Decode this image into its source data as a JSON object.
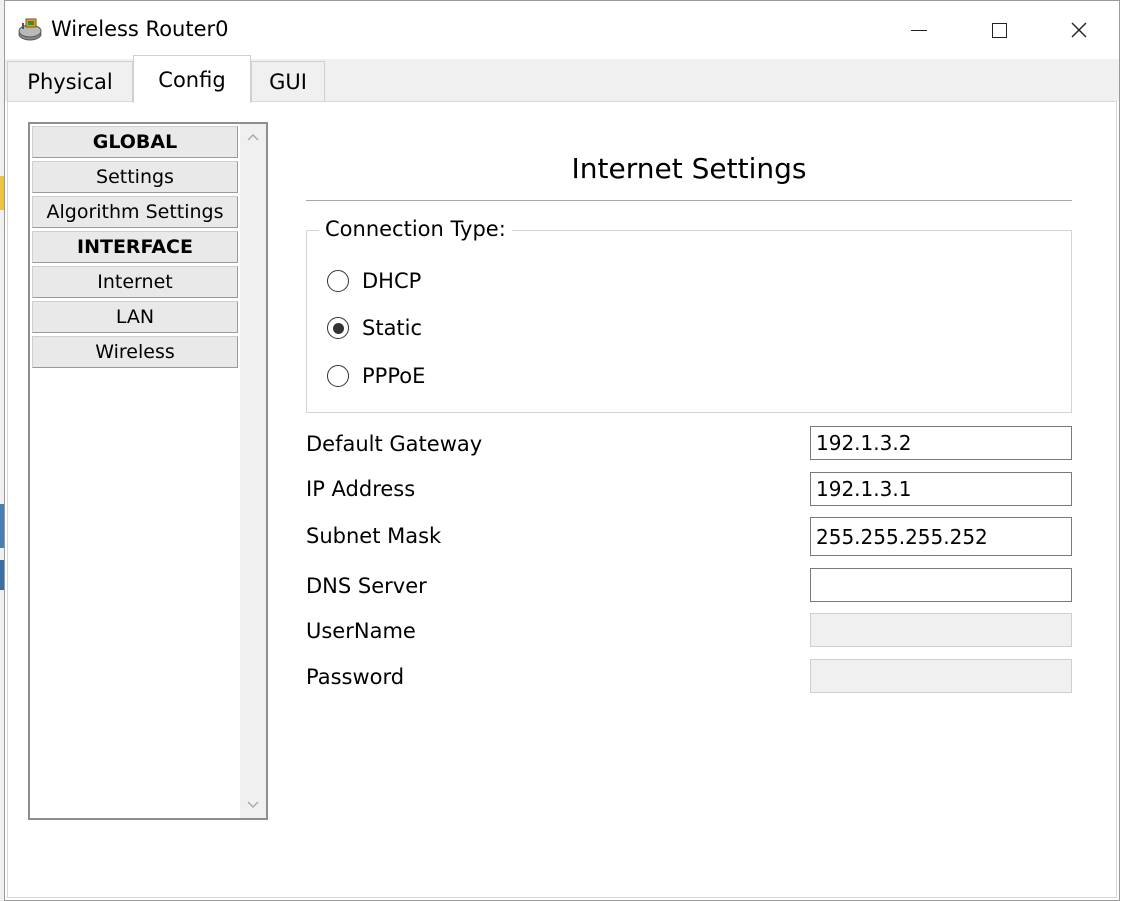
{
  "window": {
    "title": "Wireless Router0",
    "icon": "router-icon"
  },
  "tabs": [
    {
      "label": "Physical",
      "selected": false
    },
    {
      "label": "Config",
      "selected": true
    },
    {
      "label": "GUI",
      "selected": false
    }
  ],
  "sidebar": {
    "items": [
      {
        "label": "GLOBAL",
        "type": "header"
      },
      {
        "label": "Settings",
        "type": "item"
      },
      {
        "label": "Algorithm Settings",
        "type": "item"
      },
      {
        "label": "INTERFACE",
        "type": "header"
      },
      {
        "label": "Internet",
        "type": "item"
      },
      {
        "label": "LAN",
        "type": "item"
      },
      {
        "label": "Wireless",
        "type": "item"
      }
    ]
  },
  "main": {
    "heading": "Internet Settings",
    "connection_type": {
      "legend": "Connection Type:",
      "options": [
        "DHCP",
        "Static",
        "PPPoE"
      ],
      "selected": "Static"
    },
    "fields": {
      "default_gateway": {
        "label": "Default Gateway",
        "value": "192.1.3.2"
      },
      "ip_address": {
        "label": "IP Address",
        "value": "192.1.3.1"
      },
      "subnet_mask": {
        "label": "Subnet Mask",
        "value": "255.255.255.252"
      },
      "dns_server": {
        "label": "DNS Server",
        "value": ""
      },
      "username": {
        "label": "UserName",
        "value": ""
      },
      "password": {
        "label": "Password",
        "value": ""
      }
    }
  }
}
